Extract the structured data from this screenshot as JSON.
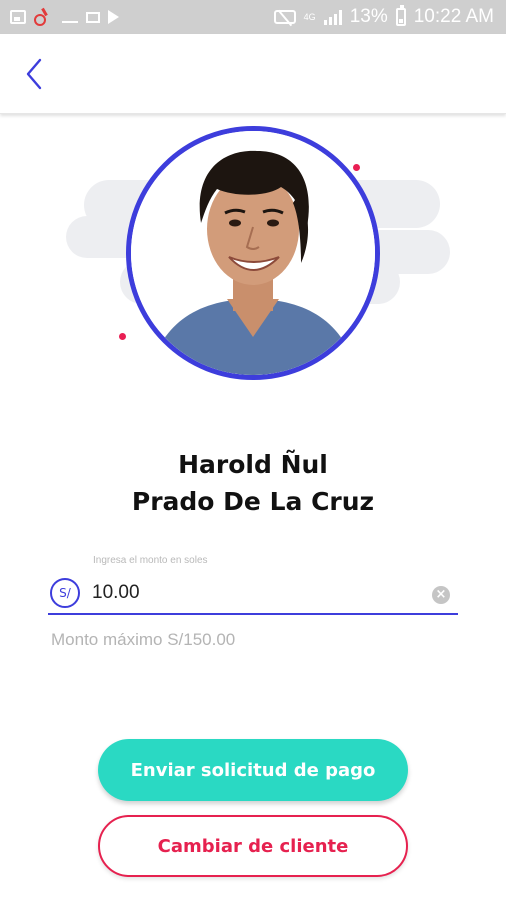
{
  "status_bar": {
    "network_type": "4G",
    "battery_percent": "13%",
    "time": "10:22 AM",
    "icons": [
      "image-icon",
      "alert-icon",
      "missed-call-icon",
      "gallery-icon",
      "play-store-icon",
      "mute-icon",
      "signal-icon",
      "battery-icon"
    ]
  },
  "app_bar": {
    "back_icon": "chevron-left-icon"
  },
  "client": {
    "name_line1": "Harold Ñul",
    "name_line2": "Prado De La Cruz"
  },
  "amount": {
    "hint": "Ingresa el monto en soles",
    "currency_symbol": "S/",
    "value": "10.00",
    "max_text": "Monto máximo S/150.00"
  },
  "actions": {
    "send_label": "Enviar solicitud de pago",
    "change_label": "Cambiar de cliente"
  },
  "colors": {
    "accent": "#3d3ddc",
    "primary_button": "#2ad9c3",
    "secondary_button": "#e6214f",
    "dots": "#e91e53"
  }
}
